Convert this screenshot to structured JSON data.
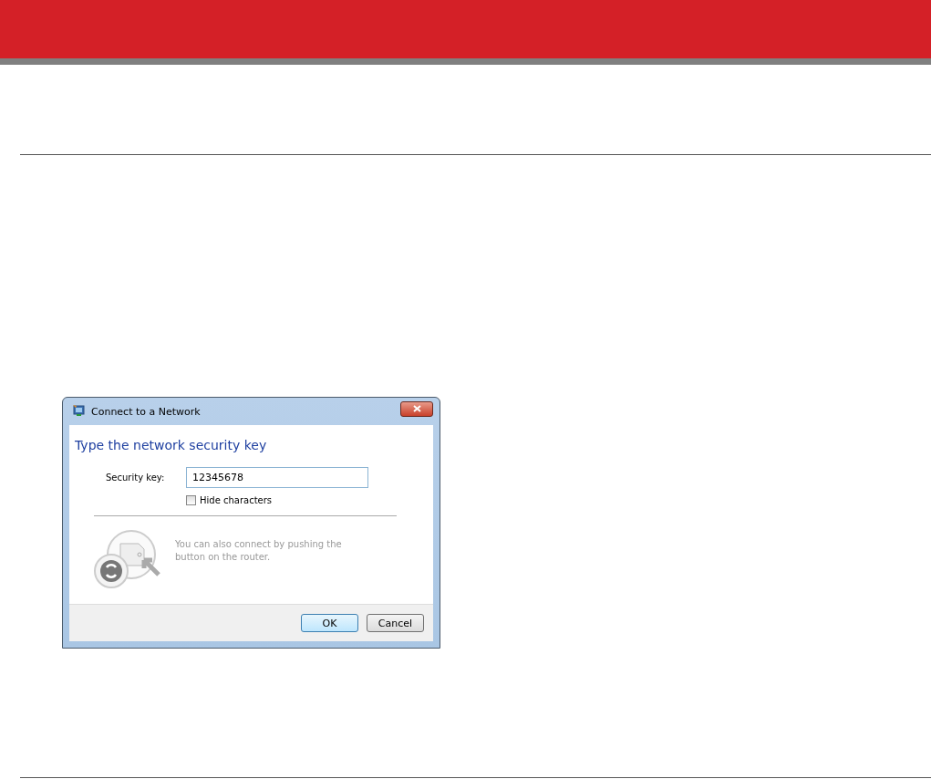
{
  "dialog": {
    "title": "Connect to a Network",
    "heading": "Type the network security key",
    "key_label": "Security key:",
    "key_value": "12345678",
    "hide_characters": {
      "label": "Hide characters",
      "checked": false
    },
    "wps_hint": "You can also connect by pushing the button on the router.",
    "buttons": [
      {
        "label": "OK",
        "default": true
      },
      {
        "label": "Cancel",
        "default": false
      }
    ]
  }
}
